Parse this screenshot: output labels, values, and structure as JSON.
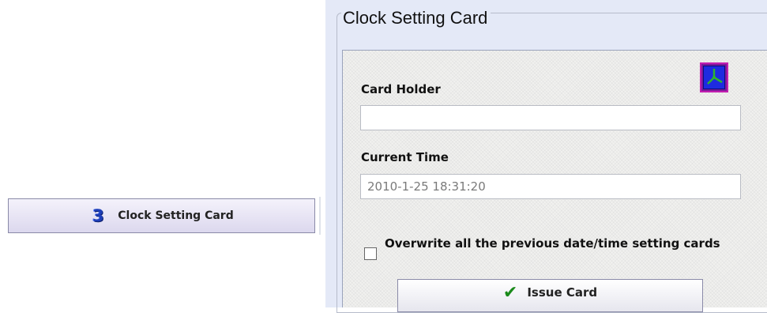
{
  "nav": {
    "step_number": "3",
    "label": "Clock Setting Card"
  },
  "panel": {
    "title": "Clock Setting Card",
    "icon": "clock-icon",
    "card_holder_label": "Card Holder",
    "card_holder_value": "",
    "current_time_label": "Current Time",
    "current_time_value": "2010-1-25 18:31:20",
    "overwrite_label": "Overwrite all the previous date/time setting cards",
    "overwrite_checked": false,
    "issue_button_label": "Issue Card"
  },
  "colors": {
    "panel_background": "#e4e9f7",
    "accent_check": "#1a8a1a",
    "clock_icon_border": "#c21fb0"
  }
}
